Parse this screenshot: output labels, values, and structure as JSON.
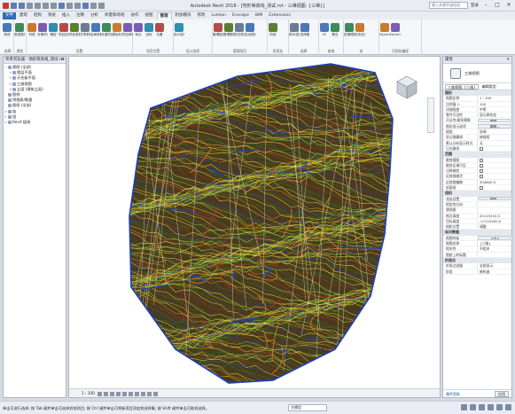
{
  "app": {
    "title": "Autodesk Revit 2018 - [地形等高线_测试.rvt - 三维视图: {三维}]",
    "search_placeholder": "键入关键字或短语",
    "user": "登录",
    "min_glyph": "–",
    "max_glyph": "□",
    "close_glyph": "✕"
  },
  "tabs": [
    "文件",
    "建筑",
    "结构",
    "系统",
    "插入",
    "注释",
    "分析",
    "体量和场地",
    "协作",
    "视图",
    "管理",
    "附加模块",
    "修改",
    "Lumion",
    "Enscape",
    "BIM",
    "Extensions"
  ],
  "ribbon": {
    "groups": [
      {
        "label": "选择",
        "buttons": [
          "修改"
        ]
      },
      {
        "label": "属性",
        "buttons": [
          "类型属性"
        ]
      },
      {
        "label": "设置",
        "buttons": [
          "材质",
          "对象样式",
          "捕捉",
          "项目信息",
          "项目参数",
          "共享参数",
          "全局参数",
          "传递项目标准",
          "清除未使用项",
          "项目单位"
        ]
      },
      {
        "label": "项目位置",
        "buttons": [
          "地点",
          "坐标",
          "位置"
        ]
      },
      {
        "label": "设计选项",
        "buttons": [
          "设计选项"
        ]
      },
      {
        "label": "管理项目",
        "buttons": [
          "管理链接",
          "管理图像",
          "贴花类型",
          "启动视图"
        ]
      },
      {
        "label": "阶段化",
        "buttons": [
          "阶段"
        ]
      },
      {
        "label": "选择",
        "buttons": [
          "按ID选择",
          "选择集"
        ]
      },
      {
        "label": "查询",
        "buttons": [
          "ID",
          "警告"
        ]
      },
      {
        "label": "宏",
        "buttons": [
          "宏管理器",
          "宏安全性"
        ]
      },
      {
        "label": "可视化编程",
        "buttons": [
          "Dynamo",
          "Dynamo 播放器"
        ]
      }
    ],
    "design_option_label": "主模型"
  },
  "project_browser": {
    "title": "项目浏览器 - 地形等高线_测试.rvt",
    "close_glyph": "✕",
    "items": [
      {
        "level": 0,
        "text": "视图 (全部)",
        "expand": "−"
      },
      {
        "level": 1,
        "text": "楼层平面",
        "expand": "+"
      },
      {
        "level": 1,
        "text": "天花板平面",
        "expand": "+"
      },
      {
        "level": 1,
        "text": "三维视图",
        "expand": "+"
      },
      {
        "level": 1,
        "text": "立面 (建筑立面)",
        "expand": "+"
      },
      {
        "level": 0,
        "text": "图例",
        "expand": ""
      },
      {
        "level": 0,
        "text": "明细表/数量",
        "expand": ""
      },
      {
        "level": 0,
        "text": "图纸 (全部)",
        "expand": ""
      },
      {
        "level": 0,
        "text": "族",
        "expand": "+"
      },
      {
        "level": 0,
        "text": "组",
        "expand": "+"
      },
      {
        "level": 0,
        "text": "Revit 链接",
        "expand": "∞"
      }
    ]
  },
  "canvas": {
    "bg": "#ffffff",
    "terrain_colors": [
      "#1f3fbf",
      "#2e7d32",
      "#9ccc3a",
      "#e5e03a",
      "#e58a2a",
      "#b5381e",
      "#5b2c16"
    ]
  },
  "view_control": {
    "scale": "1 : 100",
    "icons": [
      "detail-level",
      "visual-style",
      "sun-path",
      "shadows",
      "render",
      "crop",
      "show-crop",
      "temp-hide",
      "reveal-hidden",
      "analysis"
    ]
  },
  "properties": {
    "title": "属性",
    "close_glyph": "✕",
    "type_name": "三维视图",
    "filter_label": "三维视图: {三维}",
    "edit_type": "编辑类型",
    "sections": [
      {
        "title": "图形",
        "rows": [
          {
            "k": "视图比例",
            "v": "1 : 100",
            "kind": "input"
          },
          {
            "k": "比例值 1:",
            "v": "100"
          },
          {
            "k": "详细程度",
            "v": "中等"
          },
          {
            "k": "零件可见性",
            "v": "显示原状态"
          },
          {
            "k": "可见性/图形替换",
            "v": "编辑...",
            "kind": "btn"
          },
          {
            "k": "图形显示选项",
            "v": "编辑...",
            "kind": "btn"
          },
          {
            "k": "规程",
            "v": "协调"
          },
          {
            "k": "显示隐藏线",
            "v": "按规程"
          },
          {
            "k": "默认分析显示样式",
            "v": "无"
          },
          {
            "k": "日光路径",
            "v": "",
            "kind": "check"
          }
        ]
      },
      {
        "title": "范围",
        "rows": [
          {
            "k": "裁剪视图",
            "v": "",
            "kind": "check"
          },
          {
            "k": "裁剪区域可见",
            "v": "",
            "kind": "check"
          },
          {
            "k": "注释裁剪",
            "v": "",
            "kind": "check"
          },
          {
            "k": "远剪裁激活",
            "v": "",
            "kind": "check"
          },
          {
            "k": "远剪裁偏移",
            "v": "304800.0"
          },
          {
            "k": "剖面框",
            "v": "",
            "kind": "check"
          }
        ]
      },
      {
        "title": "相机",
        "rows": [
          {
            "k": "渲染设置",
            "v": "编辑...",
            "kind": "btn"
          },
          {
            "k": "锁定的方向",
            "v": ""
          },
          {
            "k": "透视图",
            "v": ""
          },
          {
            "k": "视点高度",
            "v": "20115532.5"
          },
          {
            "k": "目标高度",
            "v": "-11115000.0"
          },
          {
            "k": "相机位置",
            "v": "调整"
          }
        ]
      },
      {
        "title": "标识数据",
        "rows": [
          {
            "k": "视图样板",
            "v": "<无>",
            "kind": "btn"
          },
          {
            "k": "视图名称",
            "v": "{三维}"
          },
          {
            "k": "相关性",
            "v": "不相关"
          },
          {
            "k": "图纸上的标题",
            "v": ""
          }
        ]
      },
      {
        "title": "阶段化",
        "rows": [
          {
            "k": "阶段过滤器",
            "v": "全部显示"
          },
          {
            "k": "阶段",
            "v": "新构造"
          }
        ]
      }
    ],
    "help_link": "属性帮助",
    "apply": "应用"
  },
  "status": {
    "text": "单击可进行选择; 按 Tab 键并单击可选择其他项目; 按 Ctrl 键并单击可将新项目添加到选择集; 按 Shift 键并单击可取消选择。",
    "model_label": "主模型",
    "zero": ":0"
  }
}
